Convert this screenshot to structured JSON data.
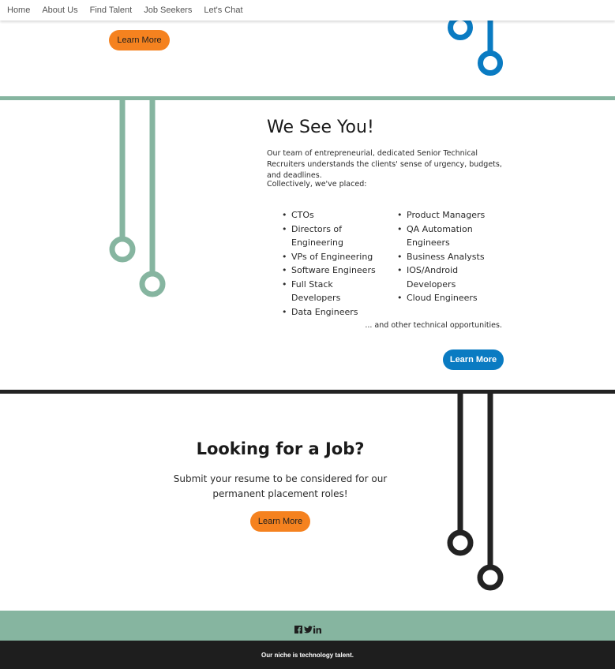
{
  "nav": {
    "items": [
      "Home",
      "About Us",
      "Find Talent",
      "Job Seekers",
      "Let's Chat"
    ]
  },
  "top": {
    "button_label": "Learn More"
  },
  "we_see_you": {
    "title": "We See You!",
    "intro": "Our team of entrepreneurial, dedicated Senior Technical Recruiters understands the clients' sense of urgency, budgets, and deadlines.",
    "placed_label": "Collectively, we've placed:",
    "left_list": [
      "CTOs",
      "Directors of Engineering",
      "VPs of Engineering",
      "Software Engineers",
      "Full Stack Developers",
      "Data Engineers"
    ],
    "right_list": [
      "Product Managers",
      "QA Automation Engineers",
      "Business Analysts",
      "IOS/Android Developers",
      "Cloud Engineers"
    ],
    "more_text": "... and other technical opportunities.",
    "button_label": "Learn More"
  },
  "job": {
    "title": "Looking for a Job?",
    "text": "Submit your resume to be considered for our permanent placement roles!",
    "button_label": "Learn More"
  },
  "footer": {
    "social_icons": [
      "facebook-icon",
      "twitter-icon",
      "linkedin-icon"
    ],
    "tagline": "Our niche is technology talent."
  },
  "colors": {
    "orange": "#f5821f",
    "blue": "#0a7bc2",
    "green": "#86b5a0",
    "dark": "#222222"
  }
}
